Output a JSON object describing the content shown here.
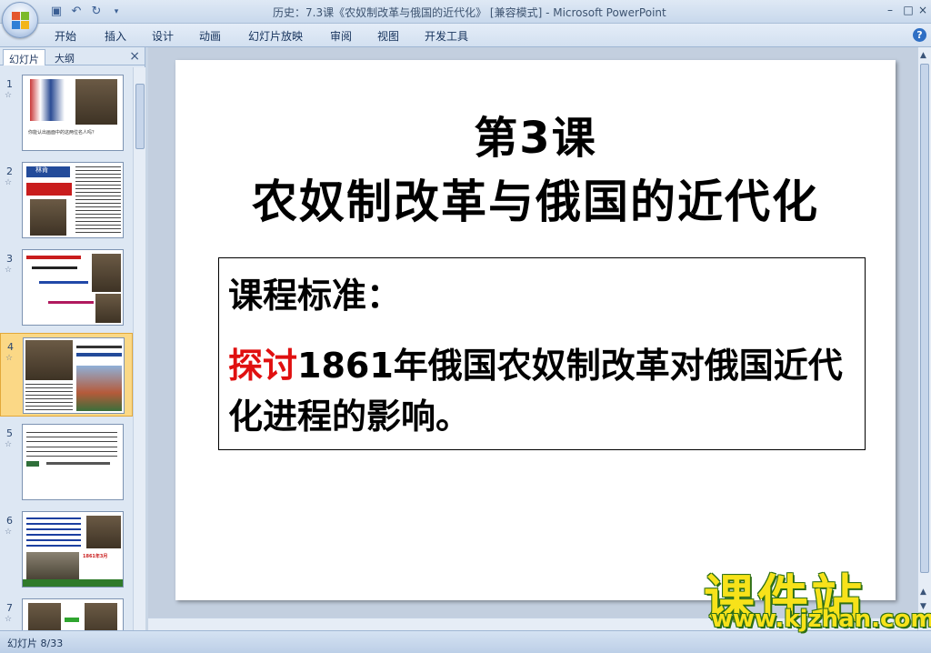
{
  "window": {
    "title": "历史：7.3课《农奴制改革与俄国的近代化》 [兼容模式] - Microsoft PowerPoint",
    "minimize": "–",
    "maximize": "□",
    "close": "×"
  },
  "quick_access": {
    "save_icon": "save-icon",
    "undo_icon": "undo-icon",
    "redo_icon": "redo-icon",
    "customize_icon": "dropdown-icon"
  },
  "menu": {
    "items": [
      "开始",
      "插入",
      "设计",
      "动画",
      "幻灯片放映",
      "审阅",
      "视图",
      "开发工具"
    ],
    "help": "?"
  },
  "left_panel": {
    "tabs": [
      "幻灯片",
      "大纲"
    ],
    "close": "×",
    "slides": [
      {
        "num": "1",
        "caption": "你能认出画面中的这两位名人吗？"
      },
      {
        "num": "2",
        "caption": "林肯"
      },
      {
        "num": "3",
        "caption": ""
      },
      {
        "num": "4",
        "caption": ""
      },
      {
        "num": "5",
        "caption": ""
      },
      {
        "num": "6",
        "caption": "1861年3月"
      },
      {
        "num": "7",
        "caption": ""
      }
    ],
    "selected_slide": "4"
  },
  "slide": {
    "title_line1": "第3课",
    "title_line2": "农奴制改革与俄国的近代化",
    "standard_heading": "课程标准：",
    "standard_keyword": "探讨",
    "standard_text": "1861年俄国农奴制改革对俄国近代化进程的影响。"
  },
  "status": {
    "slide_position": "幻灯片 8/33"
  },
  "watermark": {
    "name": "课件站",
    "url": "www.kjzhan.com"
  },
  "colors": {
    "accent_red": "#e01010",
    "selection": "#fbd886",
    "watermark_yellow": "#f7e21a"
  }
}
